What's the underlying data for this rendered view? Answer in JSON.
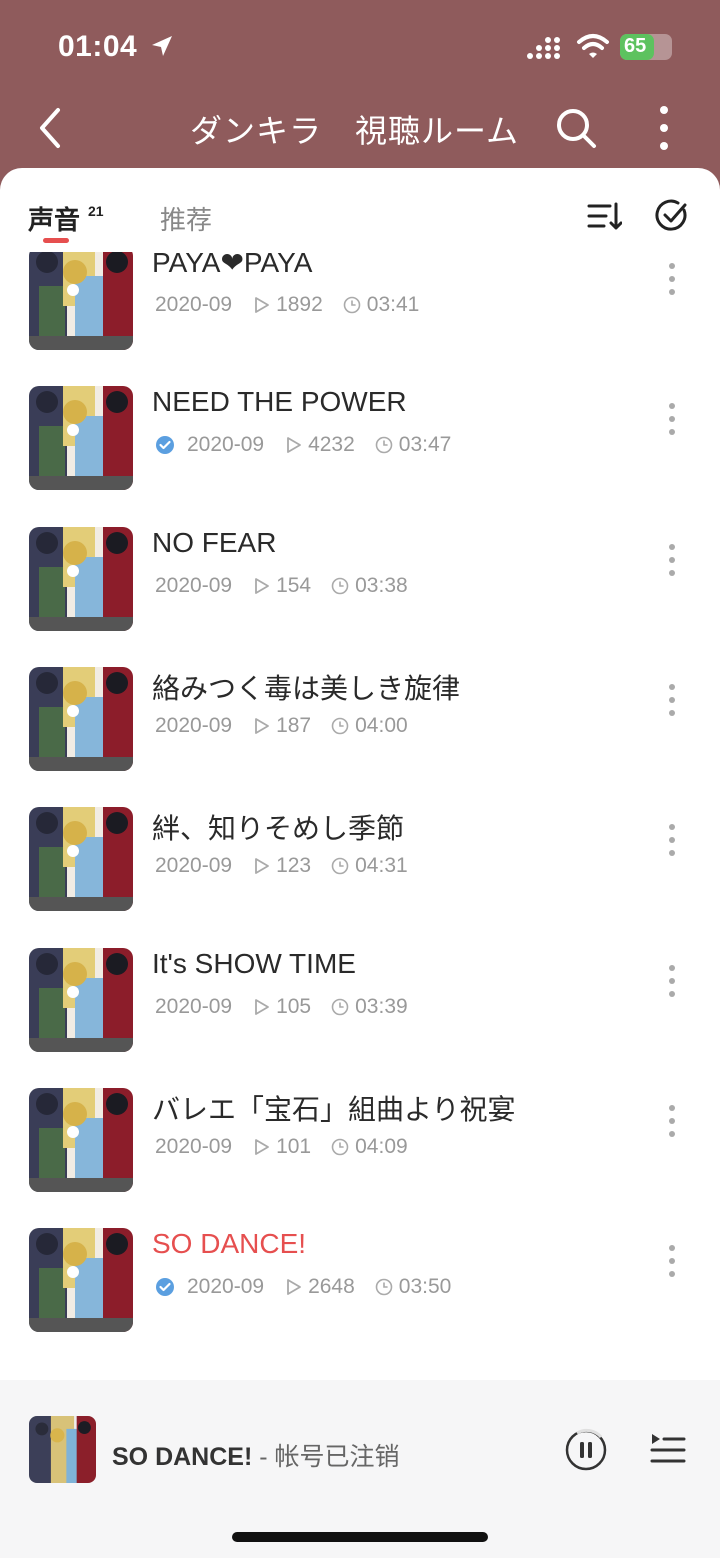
{
  "status_bar": {
    "time": "01:04",
    "battery_level": "65",
    "battery_fraction": 0.65
  },
  "nav": {
    "title": "ダンキラ　視聴ルーム",
    "back_icon": "chevron-left-icon",
    "search_icon": "search-icon",
    "more_icon": "more-vertical-icon"
  },
  "tabs": {
    "voice_label": "声音",
    "voice_count": "21",
    "recommended_label": "推荐"
  },
  "toolbar": {
    "sort_icon": "sort-list-icon",
    "select_icon": "check-circle-icon"
  },
  "tracks": [
    {
      "title": "PAYA❤PAYA",
      "date": "2020-09",
      "plays": "1892",
      "duration": "03:41",
      "verified": false,
      "playing": false
    },
    {
      "title": "NEED THE POWER",
      "date": "2020-09",
      "plays": "4232",
      "duration": "03:47",
      "verified": true,
      "playing": false
    },
    {
      "title": "NO FEAR",
      "date": "2020-09",
      "plays": "154",
      "duration": "03:38",
      "verified": false,
      "playing": false
    },
    {
      "title": "絡みつく毒は美しき旋律",
      "date": "2020-09",
      "plays": "187",
      "duration": "04:00",
      "verified": false,
      "playing": false
    },
    {
      "title": "絆、知りそめし季節",
      "date": "2020-09",
      "plays": "123",
      "duration": "04:31",
      "verified": false,
      "playing": false
    },
    {
      "title": "It's SHOW TIME",
      "date": "2020-09",
      "plays": "105",
      "duration": "03:39",
      "verified": false,
      "playing": false
    },
    {
      "title": "バレエ「宝石」組曲より祝宴",
      "date": "2020-09",
      "plays": "101",
      "duration": "04:09",
      "verified": false,
      "playing": false
    },
    {
      "title": "SO DANCE!",
      "date": "2020-09",
      "plays": "2648",
      "duration": "03:50",
      "verified": true,
      "playing": true
    }
  ],
  "player": {
    "title": "SO DANCE!",
    "artist": " - 帐号已注销",
    "pause_icon": "pause-icon",
    "queue_icon": "playlist-icon"
  },
  "colors": {
    "header": "#8f5b5c",
    "accent": "#e64f4f",
    "verified": "#5b9fe0"
  }
}
